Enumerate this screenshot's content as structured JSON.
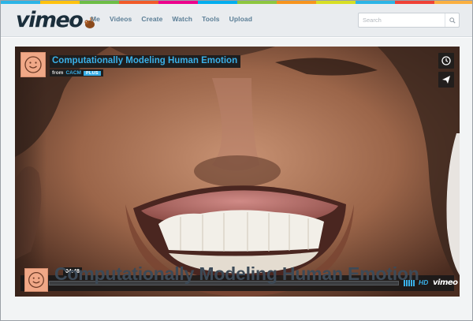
{
  "brand": {
    "logo_text": "vimeo"
  },
  "colors": {
    "stripe": [
      "#2cb4e6",
      "#ffc20e",
      "#6cbd45",
      "#f15a29",
      "#ec008c",
      "#00aeef",
      "#8dc63f",
      "#f7941d",
      "#d7df23",
      "#2cb4e6",
      "#ef4136",
      "#fbb040"
    ],
    "accent": "#3ab0e8"
  },
  "nav": {
    "items": [
      "Me",
      "Videos",
      "Create",
      "Watch",
      "Tools",
      "Upload"
    ]
  },
  "search": {
    "placeholder": "Search"
  },
  "player": {
    "title": "Computationally Modeling Human Emotion",
    "from_label": "from",
    "channel": "CACM",
    "badge": "PLUS",
    "timecode": "04:48",
    "hd_label": "HD",
    "brand_label": "vimeo",
    "side_buttons": [
      "clock-icon",
      "send-icon"
    ]
  },
  "page": {
    "title": "Computationally Modeling Human Emotion"
  }
}
